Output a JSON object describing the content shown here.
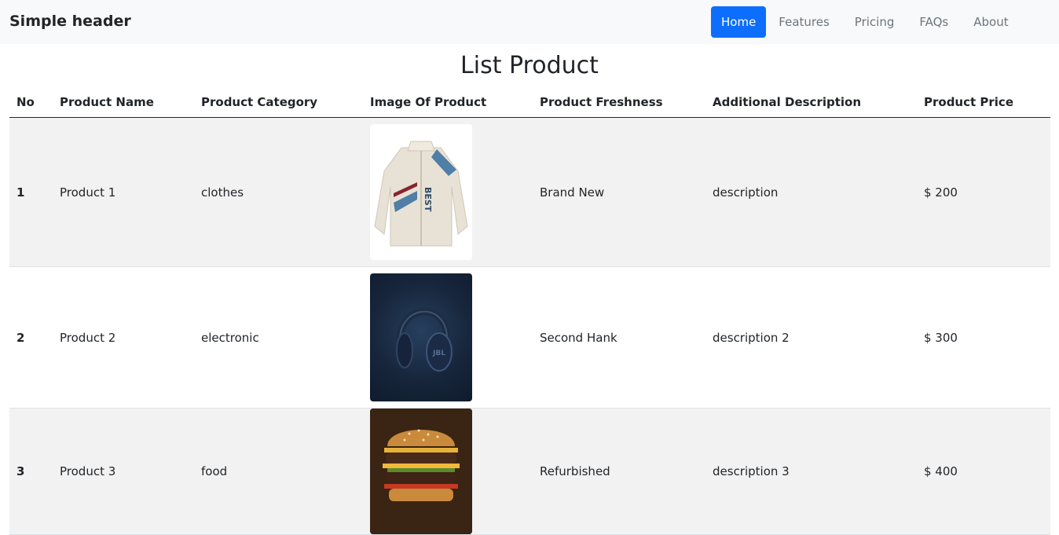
{
  "header": {
    "brand": "Simple header",
    "nav": [
      "Home",
      "Features",
      "Pricing",
      "FAQs",
      "About"
    ]
  },
  "page_title": "List Product",
  "table": {
    "columns": [
      "No",
      "Product Name",
      "Product Category",
      "Image Of Product",
      "Product Freshness",
      "Additional Description",
      "Product Price"
    ],
    "rows": [
      {
        "no": "1",
        "name": "Product 1",
        "category": "clothes",
        "image": "jacket-image",
        "freshness": "Brand New",
        "description": "description",
        "price": "$ 200"
      },
      {
        "no": "2",
        "name": "Product 2",
        "category": "electronic",
        "image": "headphones-image",
        "freshness": "Second Hank",
        "description": "description 2",
        "price": "$ 300"
      },
      {
        "no": "3",
        "name": "Product 3",
        "category": "food",
        "image": "burger-image",
        "freshness": "Refurbished",
        "description": "description 3",
        "price": "$ 400"
      }
    ]
  },
  "colors": {
    "header_bg": "#f8f9fa",
    "active_nav": "#0d6efd",
    "nav_text": "#6c757d",
    "striped_row": "#f2f2f2"
  }
}
